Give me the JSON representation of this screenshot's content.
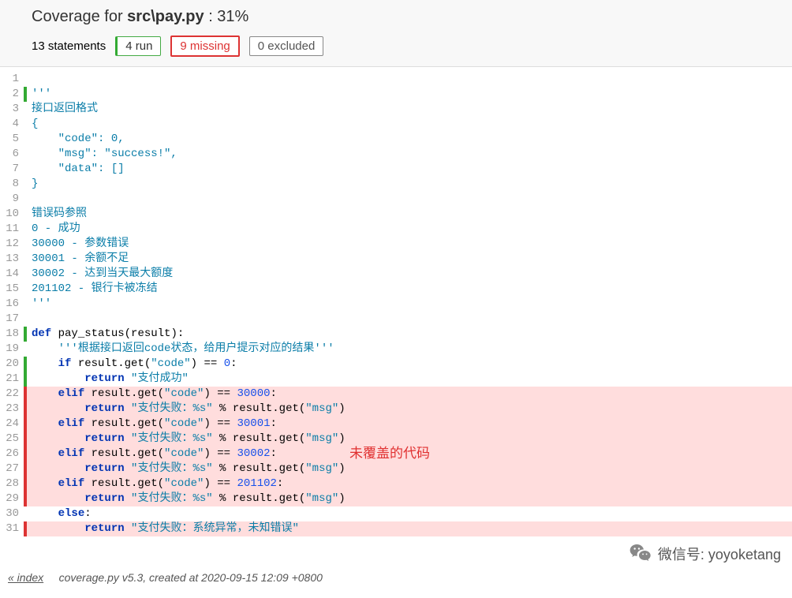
{
  "header": {
    "coverage_for": "Coverage for ",
    "filename": "src\\pay.py",
    "percent": " : 31%",
    "statements": "13 statements",
    "run": "4 run",
    "missing": "9 missing",
    "excluded": "0 excluded"
  },
  "lines": [
    {
      "n": 1,
      "m": "",
      "html": ""
    },
    {
      "n": 2,
      "m": "run",
      "html": "<span class='tok-str'>'''</span>"
    },
    {
      "n": 3,
      "m": "",
      "html": "<span class='tok-str'>接口返回格式</span>"
    },
    {
      "n": 4,
      "m": "",
      "html": "<span class='tok-str'>{</span>"
    },
    {
      "n": 5,
      "m": "",
      "html": "<span class='tok-str'>    \"code\": 0,</span>"
    },
    {
      "n": 6,
      "m": "",
      "html": "<span class='tok-str'>    \"msg\": \"success!\",</span>"
    },
    {
      "n": 7,
      "m": "",
      "html": "<span class='tok-str'>    \"data\": []</span>"
    },
    {
      "n": 8,
      "m": "",
      "html": "<span class='tok-str'>}</span>"
    },
    {
      "n": 9,
      "m": "",
      "html": ""
    },
    {
      "n": 10,
      "m": "",
      "html": "<span class='tok-str'>错误码参照</span>"
    },
    {
      "n": 11,
      "m": "",
      "html": "<span class='tok-str'>0 - 成功</span>"
    },
    {
      "n": 12,
      "m": "",
      "html": "<span class='tok-str'>30000 - 参数错误</span>"
    },
    {
      "n": 13,
      "m": "",
      "html": "<span class='tok-str'>30001 - 余额不足</span>"
    },
    {
      "n": 14,
      "m": "",
      "html": "<span class='tok-str'>30002 - 达到当天最大额度</span>"
    },
    {
      "n": 15,
      "m": "",
      "html": "<span class='tok-str'>201102 - 银行卡被冻结</span>"
    },
    {
      "n": 16,
      "m": "",
      "html": "<span class='tok-str'>'''</span>"
    },
    {
      "n": 17,
      "m": "",
      "html": ""
    },
    {
      "n": 18,
      "m": "run",
      "html": "<span class='tok-kw'>def</span> <span class='tok-def'>pay_status(result):</span>"
    },
    {
      "n": 19,
      "m": "",
      "html": "    <span class='tok-str'>'''根据接口返回code状态，给用户提示对应的结果'''</span>"
    },
    {
      "n": 20,
      "m": "run",
      "html": "    <span class='tok-kw'>if</span> result.get(<span class='tok-str'>\"code\"</span>) == <span class='tok-num'>0</span>:"
    },
    {
      "n": 21,
      "m": "run",
      "html": "        <span class='tok-kw'>return</span> <span class='tok-str'>\"支付成功\"</span>"
    },
    {
      "n": 22,
      "m": "miss",
      "html": "    <span class='tok-kw'>elif</span> result.get(<span class='tok-str'>\"code\"</span>) == <span class='tok-num'>30000</span>:"
    },
    {
      "n": 23,
      "m": "miss",
      "html": "        <span class='tok-kw'>return</span> <span class='tok-str'>\"支付失败：%s\"</span> % result.get(<span class='tok-str'>\"msg\"</span>)"
    },
    {
      "n": 24,
      "m": "miss",
      "html": "    <span class='tok-kw'>elif</span> result.get(<span class='tok-str'>\"code\"</span>) == <span class='tok-num'>30001</span>:"
    },
    {
      "n": 25,
      "m": "miss",
      "html": "        <span class='tok-kw'>return</span> <span class='tok-str'>\"支付失败：%s\"</span> % result.get(<span class='tok-str'>\"msg\"</span>)"
    },
    {
      "n": 26,
      "m": "miss",
      "html": "    <span class='tok-kw'>elif</span> result.get(<span class='tok-str'>\"code\"</span>) == <span class='tok-num'>30002</span>:"
    },
    {
      "n": 27,
      "m": "miss",
      "html": "        <span class='tok-kw'>return</span> <span class='tok-str'>\"支付失败：%s\"</span> % result.get(<span class='tok-str'>\"msg\"</span>)"
    },
    {
      "n": 28,
      "m": "miss",
      "html": "    <span class='tok-kw'>elif</span> result.get(<span class='tok-str'>\"code\"</span>) == <span class='tok-num'>201102</span>:"
    },
    {
      "n": 29,
      "m": "miss",
      "html": "        <span class='tok-kw'>return</span> <span class='tok-str'>\"支付失败：%s\"</span> % result.get(<span class='tok-str'>\"msg\"</span>)"
    },
    {
      "n": 30,
      "m": "",
      "html": "    <span class='tok-kw'>else</span>:"
    },
    {
      "n": 31,
      "m": "miss",
      "html": "        <span class='tok-kw'>return</span> <span class='tok-str'>\"支付失败：系统异常，未知错误\"</span>"
    }
  ],
  "annotation": "未覆盖的代码",
  "footer": {
    "index": "« index",
    "rest": "coverage.py v5.3, created at 2020-09-15 12:09 +0800"
  },
  "wechat": "微信号: yoyoketang"
}
